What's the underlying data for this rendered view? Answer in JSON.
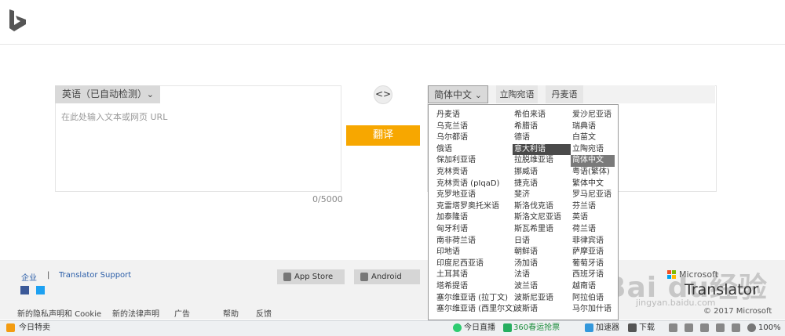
{
  "source": {
    "language_label": "英语（已自动检测）",
    "placeholder": "在此处输入文本或网页 URL",
    "char_count": "0/5000"
  },
  "swap_symbol": "<>",
  "translate_label": "翻译",
  "target": {
    "selected_label": "简体中文",
    "tabs": [
      "立陶宛语",
      "丹麦语"
    ]
  },
  "dropdown": {
    "col1": [
      "丹麦语",
      "乌克兰语",
      "乌尔都语",
      "俄语",
      "保加利亚语",
      "克林贡语",
      "克林贡语 (pIqaD)",
      "克罗地亚语",
      "克雷塔罗奥托米语",
      "加泰隆语",
      "匈牙利语",
      "南非荷兰语",
      "印地语",
      "印度尼西亚语",
      "土耳其语",
      "塔希提语",
      "塞尔维亚语 (拉丁文)",
      "塞尔维亚语 (西里尔文)"
    ],
    "col2": [
      "希伯来语",
      "希腊语",
      "德语",
      "意大利语",
      "拉脱维亚语",
      "挪威语",
      "捷克语",
      "斐济",
      "斯洛伐克语",
      "斯洛文尼亚语",
      "斯瓦希里语",
      "日语",
      "朝鲜语",
      "汤加语",
      "法语",
      "波兰语",
      "波斯尼亚语",
      "波斯语"
    ],
    "col3": [
      "爱沙尼亚语",
      "瑞典语",
      "白苗文",
      "立陶宛语",
      "简体中文",
      "粤语(繁体)",
      "繁体中文",
      "罗马尼亚语",
      "芬兰语",
      "英语",
      "荷兰语",
      "菲律宾语",
      "萨摩亚语",
      "葡萄牙语",
      "西班牙语",
      "越南语",
      "阿拉伯语",
      "马尔加什语"
    ],
    "highlight_dark": "意大利语",
    "highlight_mid": "简体中文"
  },
  "footer": {
    "link_enterprise": "企业",
    "separator": "|",
    "link_support": "Translator Support",
    "app_store": "App Store",
    "android": "Android",
    "bottom_links": [
      "新的隐私声明和 Cookie",
      "新的法律声明",
      "广告",
      "帮助",
      "反馈"
    ],
    "brand_name": "Microsoft",
    "brand_product": "Translator",
    "copyright": "© 2017 Microsoft"
  },
  "watermark": {
    "main": "Bai du经验",
    "sub": "jingyan.baidu.com"
  },
  "statusbar": {
    "left": "今日特卖",
    "items": [
      "今日直播",
      "360春运抢票",
      "加速器",
      "下载"
    ],
    "zoom": "100%"
  },
  "colors": {
    "translate": "#f7a700",
    "link": "#2b5ea8"
  }
}
